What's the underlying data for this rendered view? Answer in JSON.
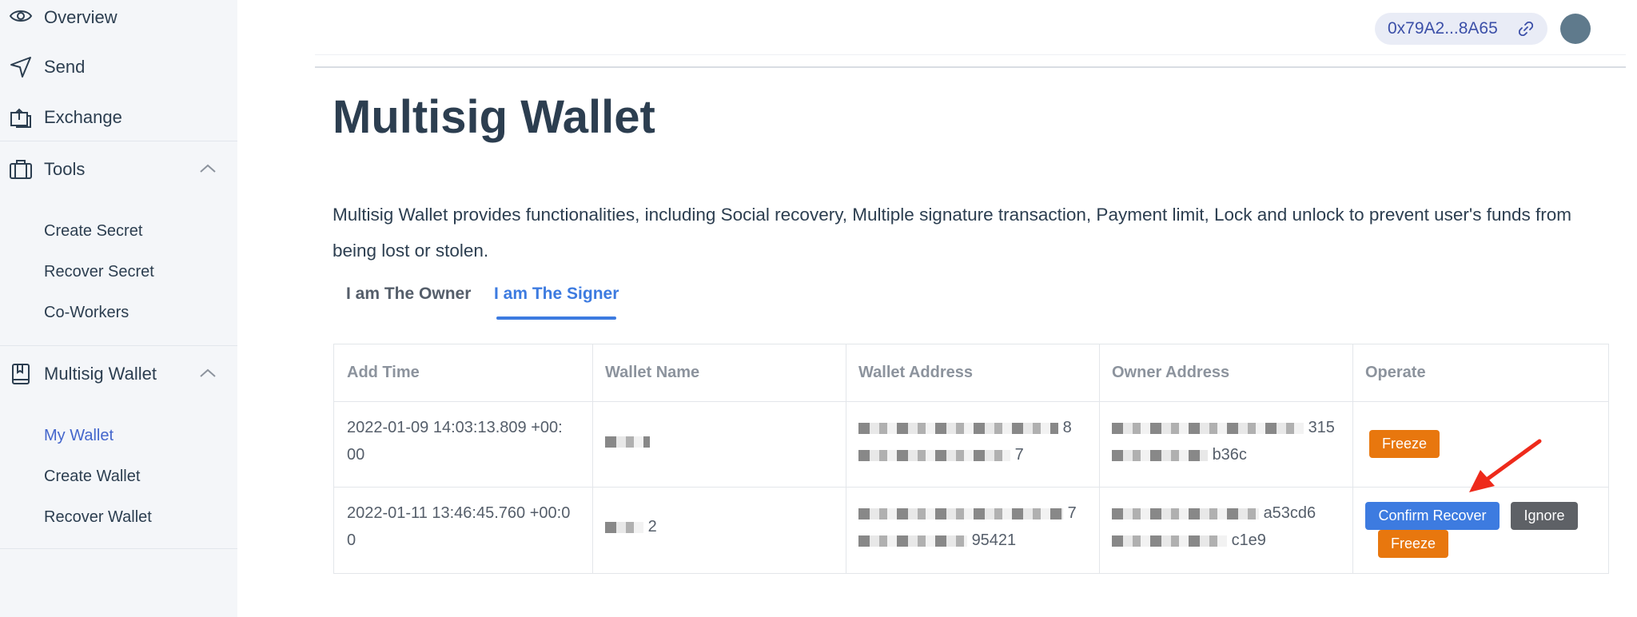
{
  "sidebar": {
    "items": [
      {
        "label": "Overview",
        "icon": "eye-icon"
      },
      {
        "label": "Send",
        "icon": "send-icon"
      },
      {
        "label": "Exchange",
        "icon": "exchange-icon"
      },
      {
        "label": "Tools",
        "icon": "toolbox-icon"
      },
      {
        "label": "Multisig Wallet",
        "icon": "book-icon"
      }
    ],
    "tools_sub": [
      "Create Secret",
      "Recover Secret",
      "Co-Workers"
    ],
    "multisig_sub": [
      "My Wallet",
      "Create Wallet",
      "Recover Wallet"
    ],
    "active_sub": "My Wallet"
  },
  "header": {
    "address": "0x79A2...8A65"
  },
  "main": {
    "title": "Multisig Wallet",
    "description": "Multisig Wallet provides functionalities, including Social recovery, Multiple signature transaction, Payment limit, Lock and unlock to prevent user's funds from being lost or stolen.",
    "tabs": [
      {
        "label": "I am The Owner",
        "active": false
      },
      {
        "label": "I am The Signer",
        "active": true
      }
    ]
  },
  "table": {
    "headers": [
      "Add Time",
      "Wallet Name",
      "Wallet Address",
      "Owner Address",
      "Operate"
    ],
    "rows": [
      {
        "add_time_1": "2022-01-09 14:03:13.809 +00:",
        "add_time_2": "00",
        "wallet_name": "",
        "wallet_address_1": "8",
        "wallet_address_2": "7",
        "owner_address_1": "315",
        "owner_address_2": "b36c",
        "buttons": {
          "freeze": "Freeze"
        }
      },
      {
        "add_time_1": "2022-01-11 13:46:45.760 +00:0",
        "add_time_2": "0",
        "wallet_name": "2",
        "wallet_address_1": "7",
        "wallet_address_2": "95421",
        "owner_address_1": "a53cd6",
        "owner_address_2": "c1e9",
        "buttons": {
          "confirm": "Confirm Recover",
          "ignore": "Ignore",
          "freeze": "Freeze"
        }
      }
    ]
  },
  "colors": {
    "accent": "#3d7be0",
    "freeze": "#e8770e",
    "ignore": "#5e6166",
    "sidebar_bg": "#f4f6f9",
    "annotation_arrow": "#ee2a1b"
  }
}
